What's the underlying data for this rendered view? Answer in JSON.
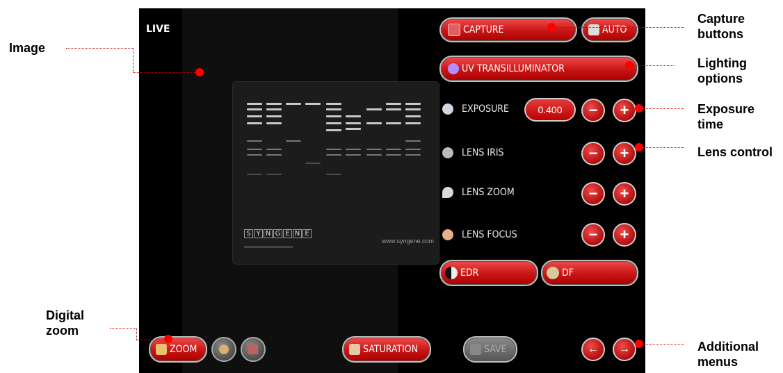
{
  "screen": {
    "live_label": "LIVE",
    "gel": {
      "brand_letters": [
        "S",
        "Y",
        "N",
        "G",
        "E",
        "N",
        "E"
      ],
      "url": "www.syngene.com"
    }
  },
  "controls": {
    "capture_label": "CAPTURE",
    "auto_label": "AUTO",
    "lighting_label": "UV TRANSILLUMINATOR",
    "exposure_label": "EXPOSURE",
    "exposure_value": "0.400",
    "lens_iris_label": "LENS IRIS",
    "lens_zoom_label": "LENS ZOOM",
    "lens_focus_label": "LENS FOCUS",
    "edr_label": "EDR",
    "df_label": "DF",
    "minus": "−",
    "plus": "+"
  },
  "bottom_bar": {
    "zoom_label": "ZOOM",
    "saturation_label": "SATURATION",
    "save_label": "SAVE",
    "prev_arrow": "←",
    "next_arrow": "→"
  },
  "callouts": {
    "image": "Image",
    "digital_zoom": "Digital zoom",
    "capture_buttons": "Capture buttons",
    "lighting_options": "Lighting options",
    "exposure_time": "Exposure time",
    "lens_control": "Lens control",
    "additional_menus": "Additional menus"
  },
  "colors": {
    "accent_red": "#c81414",
    "callout_red": "#ff0000",
    "screen_bg": "#000000"
  }
}
